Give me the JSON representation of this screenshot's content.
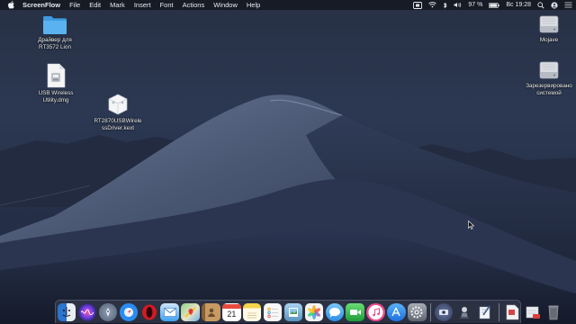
{
  "menubar": {
    "apple_icon": "apple-icon",
    "app_name": "ScreenFlow",
    "items": [
      "File",
      "Edit",
      "Mark",
      "Insert",
      "Font",
      "Actions",
      "Window",
      "Help"
    ],
    "status": {
      "battery_percent": "97 %",
      "clock": "Вс 19:28",
      "icons": [
        "screenflow-record-icon",
        "wifi-icon",
        "bluetooth-icon",
        "volume-icon",
        "battery-icon",
        "search-icon",
        "user-icon",
        "menu-list-icon"
      ]
    }
  },
  "desktop": {
    "left_icons": [
      {
        "label": "Драйвер для\nRT3572 Lion",
        "icon": "folder-icon"
      },
      {
        "label": "USB Wireless\nUtility.dmg",
        "icon": "dmg-file-icon"
      },
      {
        "label": "RT2870USBWirele\nssDriver.kext",
        "icon": "kext-file-icon"
      }
    ],
    "right_icons": [
      {
        "label": "Mojave",
        "icon": "hard-drive-icon"
      },
      {
        "label": "Зарезервировано\nсистемой",
        "icon": "hard-drive-icon"
      }
    ]
  },
  "dock": {
    "apps": [
      {
        "name": "Finder",
        "icon": "finder-icon",
        "color": "#3a8ee6"
      },
      {
        "name": "Siri",
        "icon": "siri-icon",
        "color": "#5b4fd8"
      },
      {
        "name": "Launchpad",
        "icon": "launchpad-icon",
        "color": "#6d7b8f"
      },
      {
        "name": "Safari",
        "icon": "safari-icon",
        "color": "#2d8cf0"
      },
      {
        "name": "Opera",
        "icon": "opera-icon",
        "color": "#d11a24"
      },
      {
        "name": "Mail",
        "icon": "mail-icon",
        "color": "#3ea0f0"
      },
      {
        "name": "Maps",
        "icon": "maps-icon",
        "color": "#55b06e"
      },
      {
        "name": "Contacts",
        "icon": "contacts-icon",
        "color": "#a57a4e"
      },
      {
        "name": "Calendar",
        "icon": "calendar-icon",
        "color": "#ffffff",
        "text": "21"
      },
      {
        "name": "Notes",
        "icon": "notes-icon",
        "color": "#f4d54c"
      },
      {
        "name": "Reminders",
        "icon": "reminders-icon",
        "color": "#f2f2f2"
      },
      {
        "name": "Preview",
        "icon": "preview-icon",
        "color": "#7fb6d8"
      },
      {
        "name": "Photos",
        "icon": "photos-icon",
        "color": "#f0f0f0"
      },
      {
        "name": "Messages",
        "icon": "messages-icon",
        "color": "#39a6f3"
      },
      {
        "name": "FaceTime",
        "icon": "facetime-icon",
        "color": "#33c14e"
      },
      {
        "name": "iTunes",
        "icon": "itunes-icon",
        "color": "#e94d8a"
      },
      {
        "name": "App Store",
        "icon": "app-store-icon",
        "color": "#2b7de9"
      },
      {
        "name": "System Preferences",
        "icon": "system-preferences-icon",
        "color": "#8a8f99"
      },
      {
        "name": "ScreenFlow",
        "icon": "screenflow-icon",
        "color": "#3e4a6a"
      },
      {
        "name": "Automator",
        "icon": "automator-icon",
        "color": "#5b6270"
      },
      {
        "name": "Script Editor",
        "icon": "script-editor-icon",
        "color": "#8fa0b4"
      },
      {
        "name": "Document",
        "icon": "document-icon",
        "color": "#e9e9e9"
      },
      {
        "name": "Downloads",
        "icon": "downloads-icon",
        "color": "#cfd3da"
      },
      {
        "name": "Trash",
        "icon": "trash-icon",
        "color": "#7b7f87"
      }
    ]
  }
}
